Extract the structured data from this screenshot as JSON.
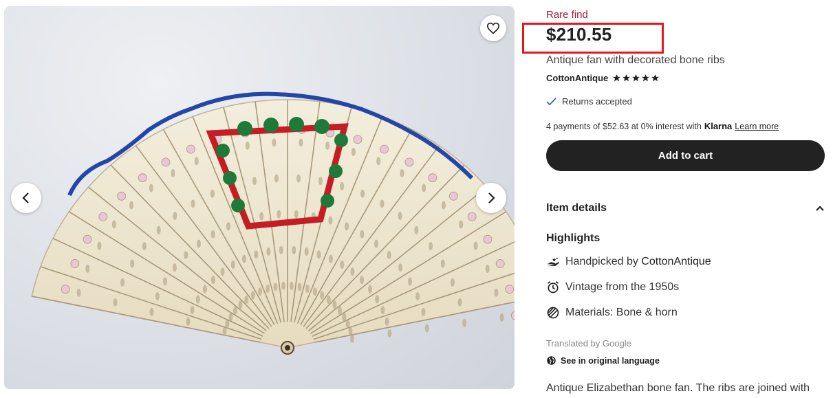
{
  "listing": {
    "badge": "Rare find",
    "price": "$210.55",
    "title": "Antique fan with decorated bone ribs",
    "shop_name": "CottonAntique",
    "rating_stars": 5,
    "returns": "Returns accepted",
    "klarna": {
      "prefix": "4 payments of $52.63 at 0% interest with",
      "brand": "Klarna",
      "link": "Learn more"
    },
    "add_to_cart": "Add to cart"
  },
  "item_details": {
    "heading": "Item details",
    "highlights_heading": "Highlights",
    "highlights": [
      {
        "icon": "hand-icon",
        "prefix": "Handpicked by ",
        "bold": "CottonAntique"
      },
      {
        "icon": "alarm-clock-icon",
        "text": "Vintage from the 1950s"
      },
      {
        "icon": "materials-icon",
        "text": "Materials: Bone & horn"
      }
    ],
    "translated": "Translated by Google",
    "see_original": "See in original language",
    "description": "Antique Elizabethan bone fan. The ribs are joined with"
  },
  "colors": {
    "badge": "#a61a2e",
    "cart_button": "#222222",
    "highlight_box": "#e8161b",
    "check": "#2a5bd7"
  }
}
